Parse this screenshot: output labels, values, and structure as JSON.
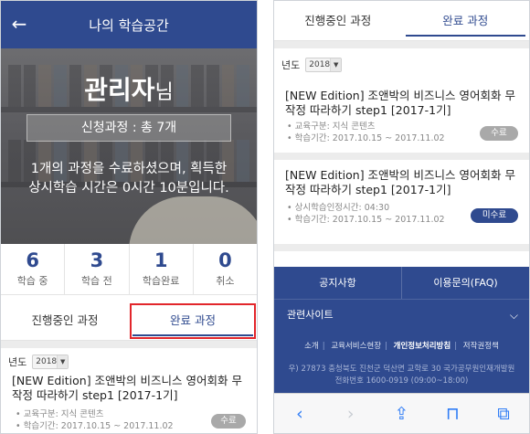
{
  "left": {
    "header": {
      "title": "나의 학습공간",
      "back_icon": "arrow-left-icon"
    },
    "hero": {
      "user_name": "관리자",
      "user_suffix": "님",
      "course_count": "신청과정 : 총 7개",
      "message": "1개의 과정을 수료하셨으며, 획득한 상시학습 시간은 0시간 10분입니다."
    },
    "stats": [
      {
        "value": "6",
        "label": "학습 중"
      },
      {
        "value": "3",
        "label": "학습 전"
      },
      {
        "value": "1",
        "label": "학습완료"
      },
      {
        "value": "0",
        "label": "취소"
      }
    ],
    "tabs": [
      "진행중인 과정",
      "완료 과정"
    ],
    "active_tab": "완료 과정",
    "year_label": "년도",
    "year_value": "2018",
    "course": {
      "title": "[NEW Edition] 조앤박의 비즈니스 영어회화 무작정 따라하기 step1 [2017-1기]",
      "meta1": "교육구분: 지식 콘텐츠",
      "meta2": "학습기간: 2017.10.15 ~ 2017.11.02",
      "status": "수료"
    }
  },
  "right": {
    "tabs": [
      "진행중인 과정",
      "완료 과정"
    ],
    "active_tab": "완료 과정",
    "year_label": "년도",
    "year_value": "2018",
    "courses": [
      {
        "title": "[NEW Edition] 조앤박의 비즈니스 영어회화 무작정 따라하기 step1 [2017-1기]",
        "meta1": "교육구분: 지식 콘텐츠",
        "meta2": "학습기간: 2017.10.15 ~ 2017.11.02",
        "status": "수료"
      },
      {
        "title": "[NEW Edition] 조앤박의 비즈니스 영어회화 무작정 따라하기 step1 [2017-1기]",
        "meta1": "상시학습인정시간: 04:30",
        "meta2": "학습기간: 2017.10.15 ~ 2017.11.02",
        "status": "미수료"
      }
    ],
    "footer": {
      "notice": "공지사항",
      "faq": "이용문의(FAQ)",
      "related": "관련사이트",
      "sub_links": [
        "소개",
        "교육서비스현장",
        "개인정보처리방침",
        "저작권정책"
      ],
      "address_line1": "우) 27873 충청북도 진천군 덕산면 교학로 30 국가공무원인재개발원",
      "address_line2": "전화번호 1600-0919 (09:00~18:00)"
    },
    "browser_icons": [
      "back-chevron-icon",
      "forward-chevron-icon",
      "share-icon",
      "bookmarks-icon",
      "tabs-icon"
    ]
  },
  "colors": {
    "brand_blue": "#2f4a8f",
    "highlight_red": "#e2262b",
    "pill_gray": "#a9a9a9"
  }
}
